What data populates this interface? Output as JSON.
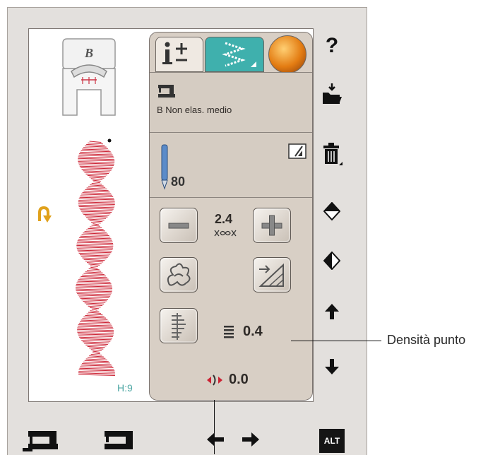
{
  "stitch_panel": {
    "foot_letter": "B",
    "foot_label": "B Non elas. medio",
    "needle_size": "80",
    "stitch_width": "2.4",
    "stitch_density": "0.4",
    "offset_value": "0.0"
  },
  "stitch_preview": {
    "h_label": "H:9",
    "stitch_color": "#cc2233"
  },
  "sidebar": {
    "help_label": "?"
  },
  "bottom_bar": {
    "alt_label": "ALT"
  },
  "callout": {
    "label": "Densità punto"
  },
  "colors": {
    "tab_active": "#3fb0ad",
    "panel_bg": "#d8cfc5",
    "device_bg": "#e3e0dd",
    "h_label": "#4ea7a4"
  }
}
